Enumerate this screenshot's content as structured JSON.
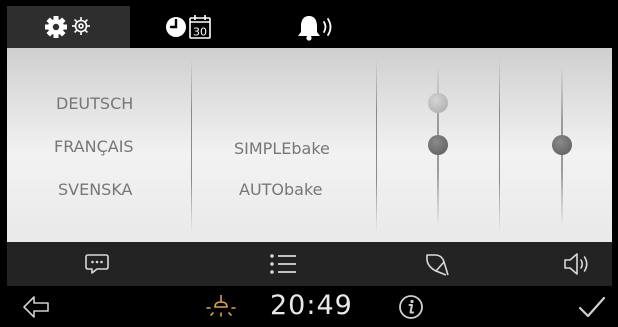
{
  "tabs": [
    {
      "id": "settings",
      "icon": "gear-icon",
      "active": true
    },
    {
      "id": "clock-calendar",
      "icon": "clock-calendar-icon",
      "label": "30",
      "active": false
    },
    {
      "id": "alarm",
      "icon": "bell-sound-icon",
      "active": false
    }
  ],
  "languages": {
    "options": [
      "DEUTSCH",
      "FRANÇAIS",
      "SVENSKA"
    ]
  },
  "bake_modes": {
    "options": [
      "SIMPLEbake",
      "AUTObake"
    ]
  },
  "sliders": {
    "brightness": {
      "levels": 2,
      "selected": 2
    },
    "volume": {
      "selected": "middle"
    }
  },
  "function_bar": [
    {
      "id": "language",
      "icon": "speech-bubble-icon"
    },
    {
      "id": "mode",
      "icon": "list-icon"
    },
    {
      "id": "display",
      "icon": "brightness-icon"
    },
    {
      "id": "volume",
      "icon": "speaker-icon"
    }
  ],
  "status": {
    "time": "20:49",
    "back_icon": "back-arrow-icon",
    "light_icon": "light-bulb-icon",
    "info_icon": "info-icon",
    "confirm_icon": "checkmark-icon"
  },
  "colors": {
    "background": "#000000",
    "panel_top": "#cfcfcf",
    "panel_mid": "#f2f2f2",
    "text": "#777777",
    "function_bar": "#232323",
    "tab_active": "#2e2e2e",
    "icon": "#d9d9d9"
  }
}
